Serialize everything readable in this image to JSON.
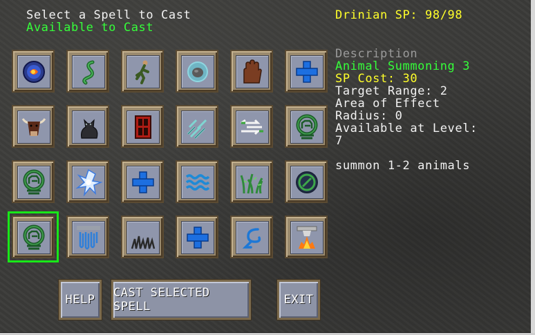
{
  "header": {
    "title": "Select a Spell to Cast",
    "subtitle": "Available to Cast",
    "caster": "Drinian SP: 98/98"
  },
  "details": {
    "heading": "Description",
    "spell_name": "Animal Summoning 3",
    "sp_cost": "SP Cost: 30",
    "target_range": "Target Range: 2",
    "area_line1": "Area of Effect",
    "area_line2": "Radius: 0",
    "level_line1": "Available at Level:",
    "level_line2": "7",
    "description": "summon 1-2 animals"
  },
  "spells": [
    {
      "icon": "fire-orb-icon"
    },
    {
      "icon": "green-serpent-icon"
    },
    {
      "icon": "running-man-icon"
    },
    {
      "icon": "stone-orb-icon"
    },
    {
      "icon": "brown-hand-icon"
    },
    {
      "icon": "blue-cross-icon"
    },
    {
      "icon": "bull-head-icon"
    },
    {
      "icon": "black-cat-icon"
    },
    {
      "icon": "red-door-icon"
    },
    {
      "icon": "ice-shards-icon"
    },
    {
      "icon": "white-arrows-icon"
    },
    {
      "icon": "animal-summon-icon"
    },
    {
      "icon": "animal-summon-icon"
    },
    {
      "icon": "lightning-burst-icon"
    },
    {
      "icon": "blue-cross-icon"
    },
    {
      "icon": "water-waves-icon"
    },
    {
      "icon": "green-vines-icon"
    },
    {
      "icon": "green-sigil-icon"
    },
    {
      "icon": "animal-summon-icon",
      "selected": true
    },
    {
      "icon": "blue-rain-icon"
    },
    {
      "icon": "dark-grass-icon"
    },
    {
      "icon": "blue-cross-icon"
    },
    {
      "icon": "blue-hook-icon"
    },
    {
      "icon": "lava-pillar-icon"
    }
  ],
  "buttons": {
    "help": "HELP",
    "cast": "CAST SELECTED SPELL",
    "exit": "EXIT"
  },
  "colors": {
    "selected_outline": "#18e818",
    "highlight_green": "#35ff3a",
    "highlight_yellow": "#ffff2a"
  }
}
